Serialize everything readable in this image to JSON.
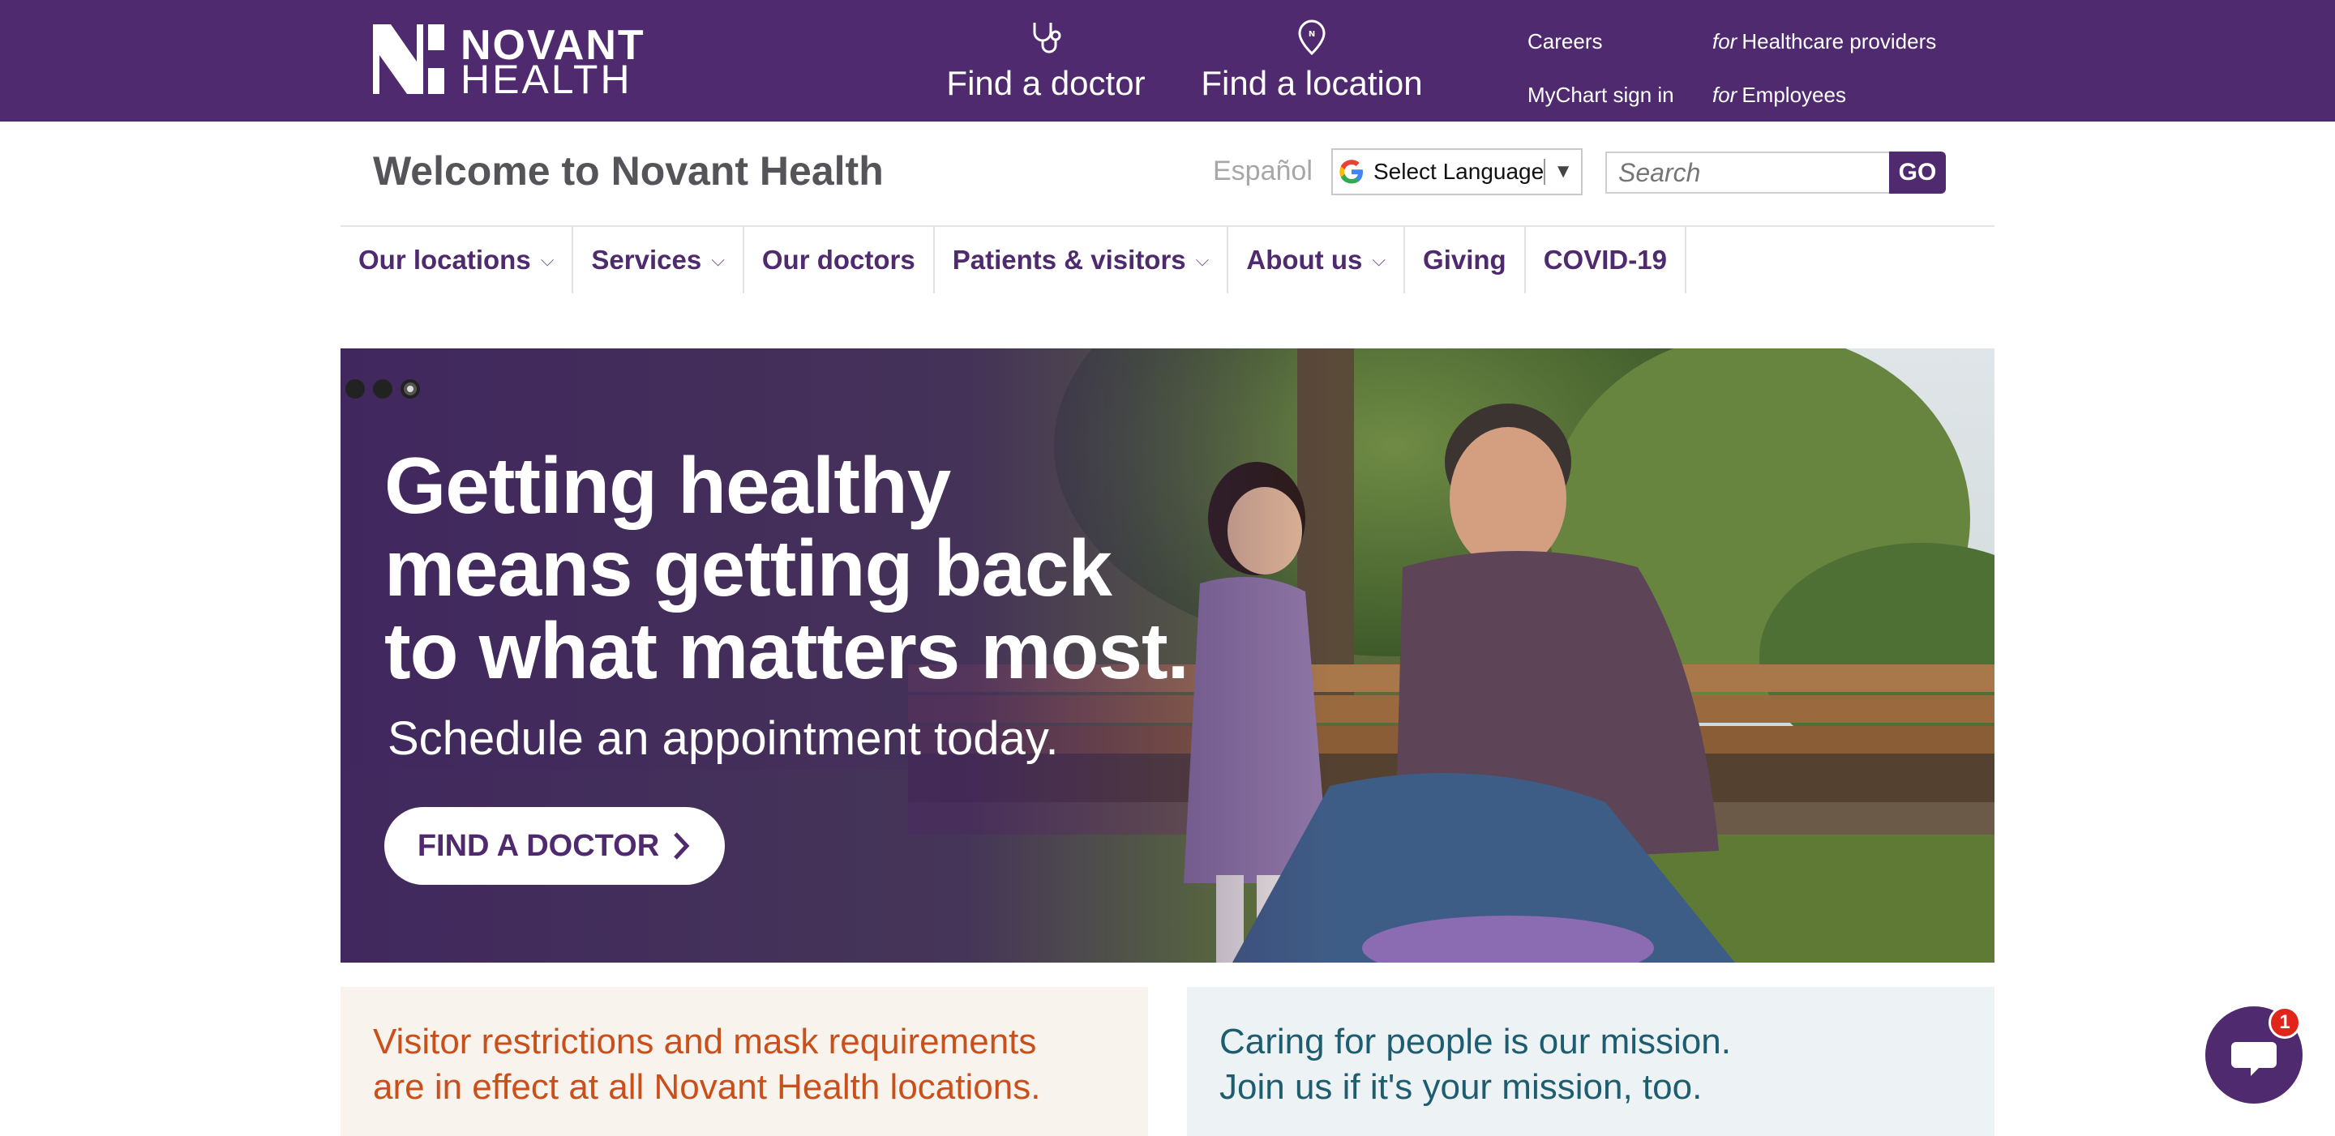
{
  "brand": {
    "logo_top": "NOVANT",
    "logo_bottom": "HEALTH",
    "primary_color": "#4f2a6e"
  },
  "topbar": {
    "find_doctor": "Find a doctor",
    "find_location": "Find a location",
    "careers": "Careers",
    "mychart": "MyChart sign in",
    "hc_prefix": "for",
    "hc_label": "Healthcare providers",
    "emp_prefix": "for",
    "emp_label": "Employees"
  },
  "header": {
    "welcome": "Welcome to Novant Health",
    "espanol": "Español",
    "select_language": "Select Language",
    "search_placeholder": "Search",
    "go": "GO"
  },
  "nav": {
    "our_locations": "Our locations",
    "services": "Services",
    "our_doctors": "Our doctors",
    "patients_visitors": "Patients & visitors",
    "about_us": "About us",
    "giving": "Giving",
    "covid": "COVID-19"
  },
  "hero": {
    "headline": "Getting healthy means getting back to what matters most.",
    "subheadline": "Schedule an appointment today.",
    "cta": "FIND A DOCTOR",
    "slides_total": 3,
    "active_slide": 3
  },
  "cards": {
    "alert": "Visitor restrictions and mask requirements are in effect at all Novant Health locations.",
    "mission_line1": "Caring for people is our mission.",
    "mission_line2": "Join us if it's your mission, too."
  },
  "chat": {
    "badge_count": "1"
  }
}
